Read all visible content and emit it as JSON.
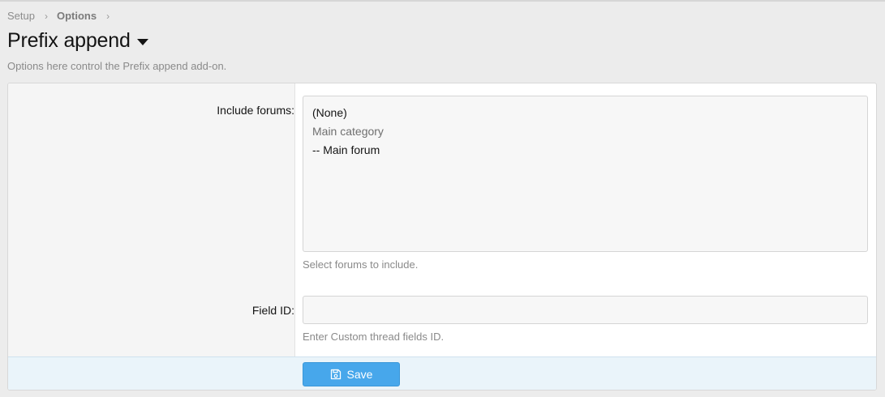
{
  "breadcrumb": {
    "items": [
      "Setup",
      "Options"
    ],
    "separator": "›"
  },
  "header": {
    "title": "Prefix append",
    "description": "Options here control the Prefix append add-on."
  },
  "form": {
    "include_forums": {
      "label": "Include forums:",
      "options": [
        "(None)",
        "Main category",
        "-- Main forum"
      ],
      "hint": "Select forums to include."
    },
    "field_id": {
      "label": "Field ID:",
      "value": "",
      "hint": "Enter Custom thread fields ID."
    },
    "save_label": "Save",
    "save_icon": "save-icon"
  },
  "colors": {
    "accent": "#47a7eb",
    "footer_bg": "#eaf4fa"
  }
}
